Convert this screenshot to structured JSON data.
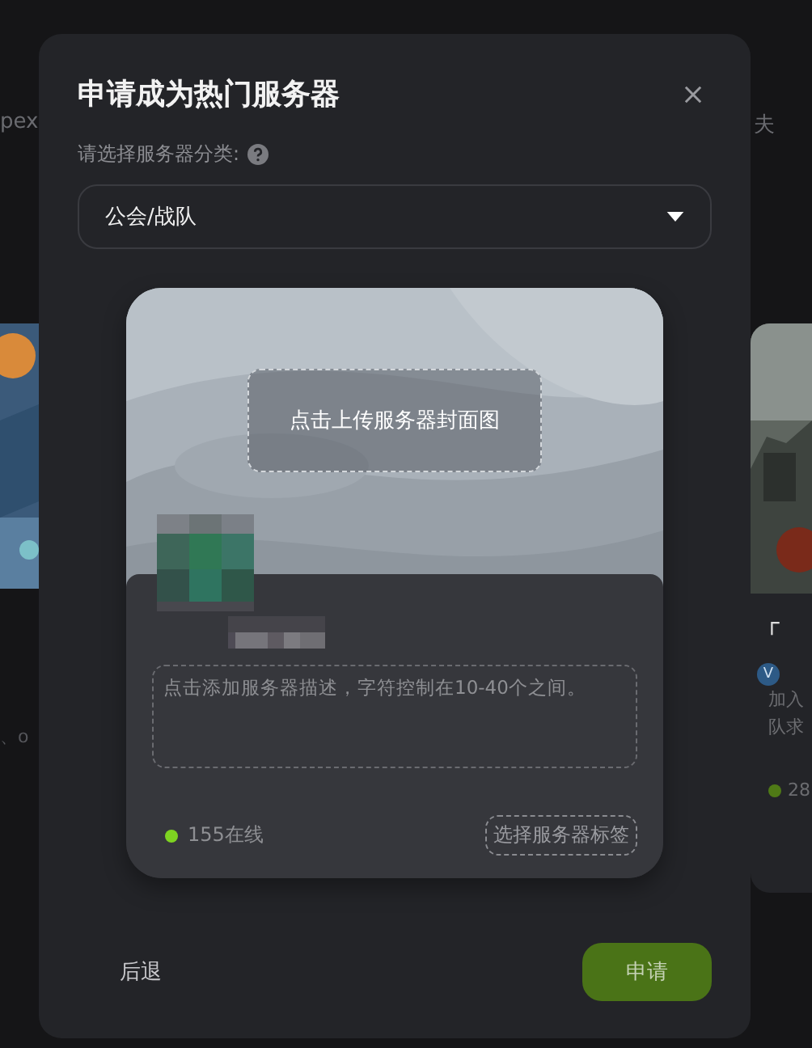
{
  "background_page": {
    "left_text": "pex",
    "right_text": "夫",
    "left_card": {
      "kind": "picture",
      "caption": "、o"
    },
    "right_card": {
      "kind": "picture",
      "title": "「",
      "badge": "V",
      "description_lines": [
        "加入",
        "队求"
      ],
      "online": "28"
    }
  },
  "dialog": {
    "title": "申请成为热门服务器",
    "category_label": "请选择服务器分类:",
    "category": {
      "value": "公会/战队"
    },
    "preview": {
      "upload_cover": "点击上传服务器封面图",
      "description": {
        "placeholder": "点击添加服务器描述，字符控制在10-40个之间。"
      },
      "online": "155在线",
      "tag_button": "选择服务器标签"
    },
    "buttons": [
      {
        "label": "后退",
        "kind": "text"
      },
      {
        "label": "申请",
        "kind": "primary"
      }
    ]
  }
}
